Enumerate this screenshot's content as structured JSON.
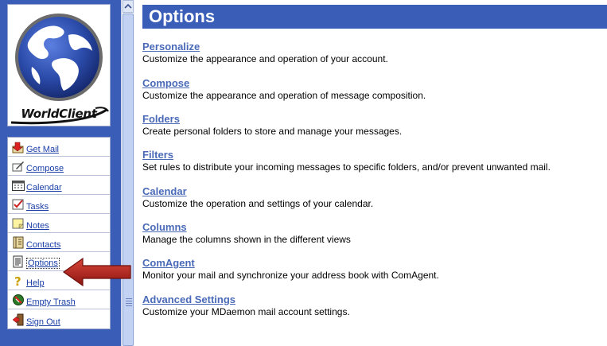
{
  "logo": {
    "text": "WorldClient"
  },
  "nav": {
    "items": [
      {
        "label": "Get Mail",
        "icon": "get-mail-icon"
      },
      {
        "label": "Compose",
        "icon": "compose-icon"
      },
      {
        "label": "Calendar",
        "icon": "calendar-icon"
      },
      {
        "label": "Tasks",
        "icon": "tasks-icon"
      },
      {
        "label": "Notes",
        "icon": "notes-icon"
      },
      {
        "label": "Contacts",
        "icon": "contacts-icon"
      },
      {
        "label": "Options",
        "icon": "options-icon",
        "selected": true
      },
      {
        "label": "Help",
        "icon": "help-icon"
      },
      {
        "label": "Empty Trash",
        "icon": "empty-trash-icon"
      },
      {
        "label": "Sign Out",
        "icon": "sign-out-icon"
      }
    ]
  },
  "page": {
    "title": "Options"
  },
  "sections": [
    {
      "link": "Personalize",
      "desc": "Customize the appearance and operation of your account."
    },
    {
      "link": "Compose",
      "desc": "Customize the appearance and operation of message composition."
    },
    {
      "link": "Folders",
      "desc": "Create personal folders to store and manage your messages."
    },
    {
      "link": "Filters",
      "desc": "Set rules to distribute your incoming messages to specific folders, and/or prevent unwanted mail."
    },
    {
      "link": "Calendar",
      "desc": "Customize the operation and settings of your calendar."
    },
    {
      "link": "Columns",
      "desc": "Manage the columns shown in the different views"
    },
    {
      "link": "ComAgent",
      "desc": "Monitor your mail and synchronize your address book with ComAgent."
    },
    {
      "link": "Advanced Settings",
      "desc": "Customize your MDaemon mail account settings."
    }
  ],
  "colors": {
    "accent": "#3a5db8",
    "link": "#4a6ab8",
    "arrow": "#b0221a"
  }
}
